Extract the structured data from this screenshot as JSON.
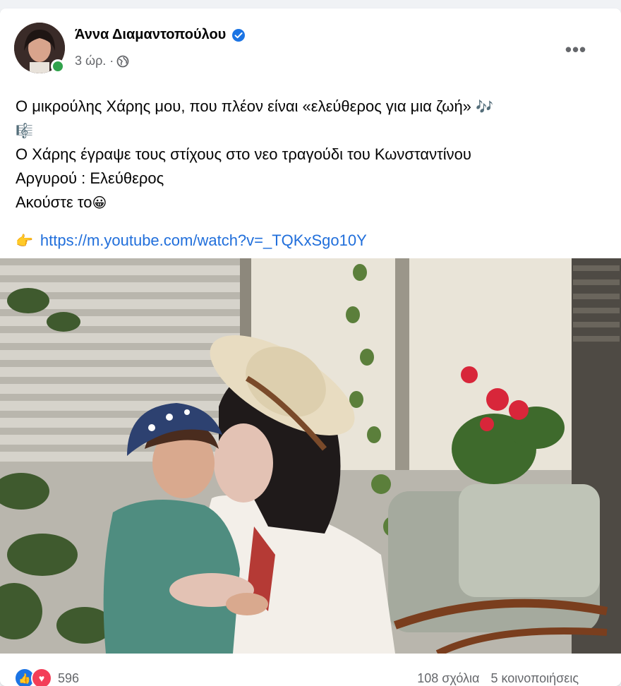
{
  "post": {
    "author": "Άννα Διαμαντοπούλου",
    "time": "3 ώρ. ·",
    "more_label": "•••",
    "privacy_icon": "globe-icon",
    "text_line_1": "Ο μικρούλης Χάρης μου, που πλέον είναι «ελεύθερος για μια ζωή»",
    "text_line_1_emoji": "🎶",
    "text_line_2_emoji": "🎼",
    "text_line_3": "Ο Χάρης έγραψε τους στίχους στο νεο τραγούδι του Κωνσταντίνου",
    "text_line_4": "Αργυρού : Ελεύθερος",
    "text_line_5": "Ακούστε το",
    "text_line_5_emoji": "😀",
    "link_emoji": "👉",
    "link": "https://m.youtube.com/watch?v=_TQKxSgo10Y"
  },
  "stats": {
    "reaction_count": "596",
    "comments": "108 σχόλια",
    "shares": "5 κοινοποιήσεις"
  },
  "colors": {
    "link": "#216fdb",
    "verified": "#1b74e4",
    "online": "#31a24c",
    "secondary_text": "#65676b"
  }
}
